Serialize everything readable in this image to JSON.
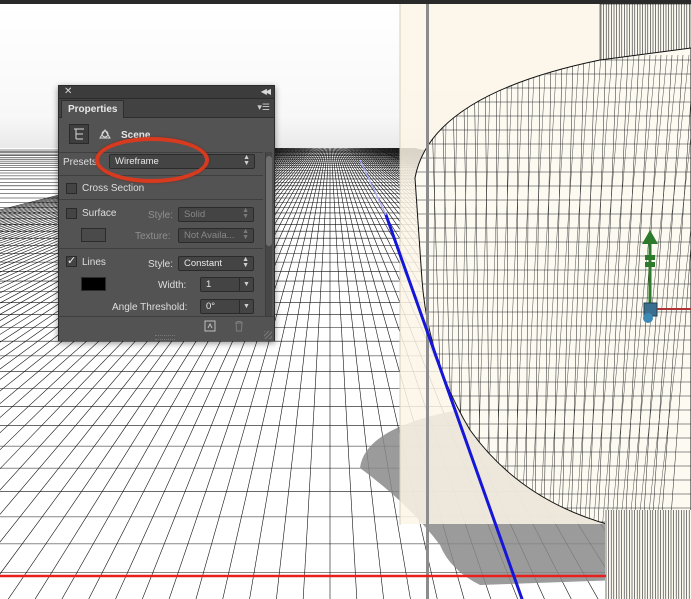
{
  "panel": {
    "tab_label": "Properties",
    "scene_label": "Scene",
    "presets_label": "Presets",
    "presets_value": "Wireframe",
    "cross_section_label": "Cross Section",
    "cross_section_checked": false,
    "surface_label": "Surface",
    "surface_checked": false,
    "surface_style_label": "Style:",
    "surface_style_value": "Solid",
    "surface_texture_label": "Texture:",
    "surface_texture_value": "Not Availa...",
    "lines_label": "Lines",
    "lines_checked": true,
    "lines_style_label": "Style:",
    "lines_style_value": "Constant",
    "lines_color": "#000000",
    "width_label": "Width:",
    "width_value": "1",
    "angle_threshold_label": "Angle Threshold:",
    "angle_threshold_value": "0°",
    "icons": {
      "close": "close-icon",
      "collapse": "double-chevron-icon",
      "menu": "panel-menu-icon",
      "scene": "scene-tree-icon",
      "camera": "camera-view-icon",
      "render": "render-icon",
      "delete": "trash-icon"
    }
  },
  "colors": {
    "annotation": "#d73a1f",
    "x_axis": "#e8201c",
    "z_axis": "#1616d8",
    "gizmo": "#2d7a2d",
    "panel_bg": "#535353"
  }
}
